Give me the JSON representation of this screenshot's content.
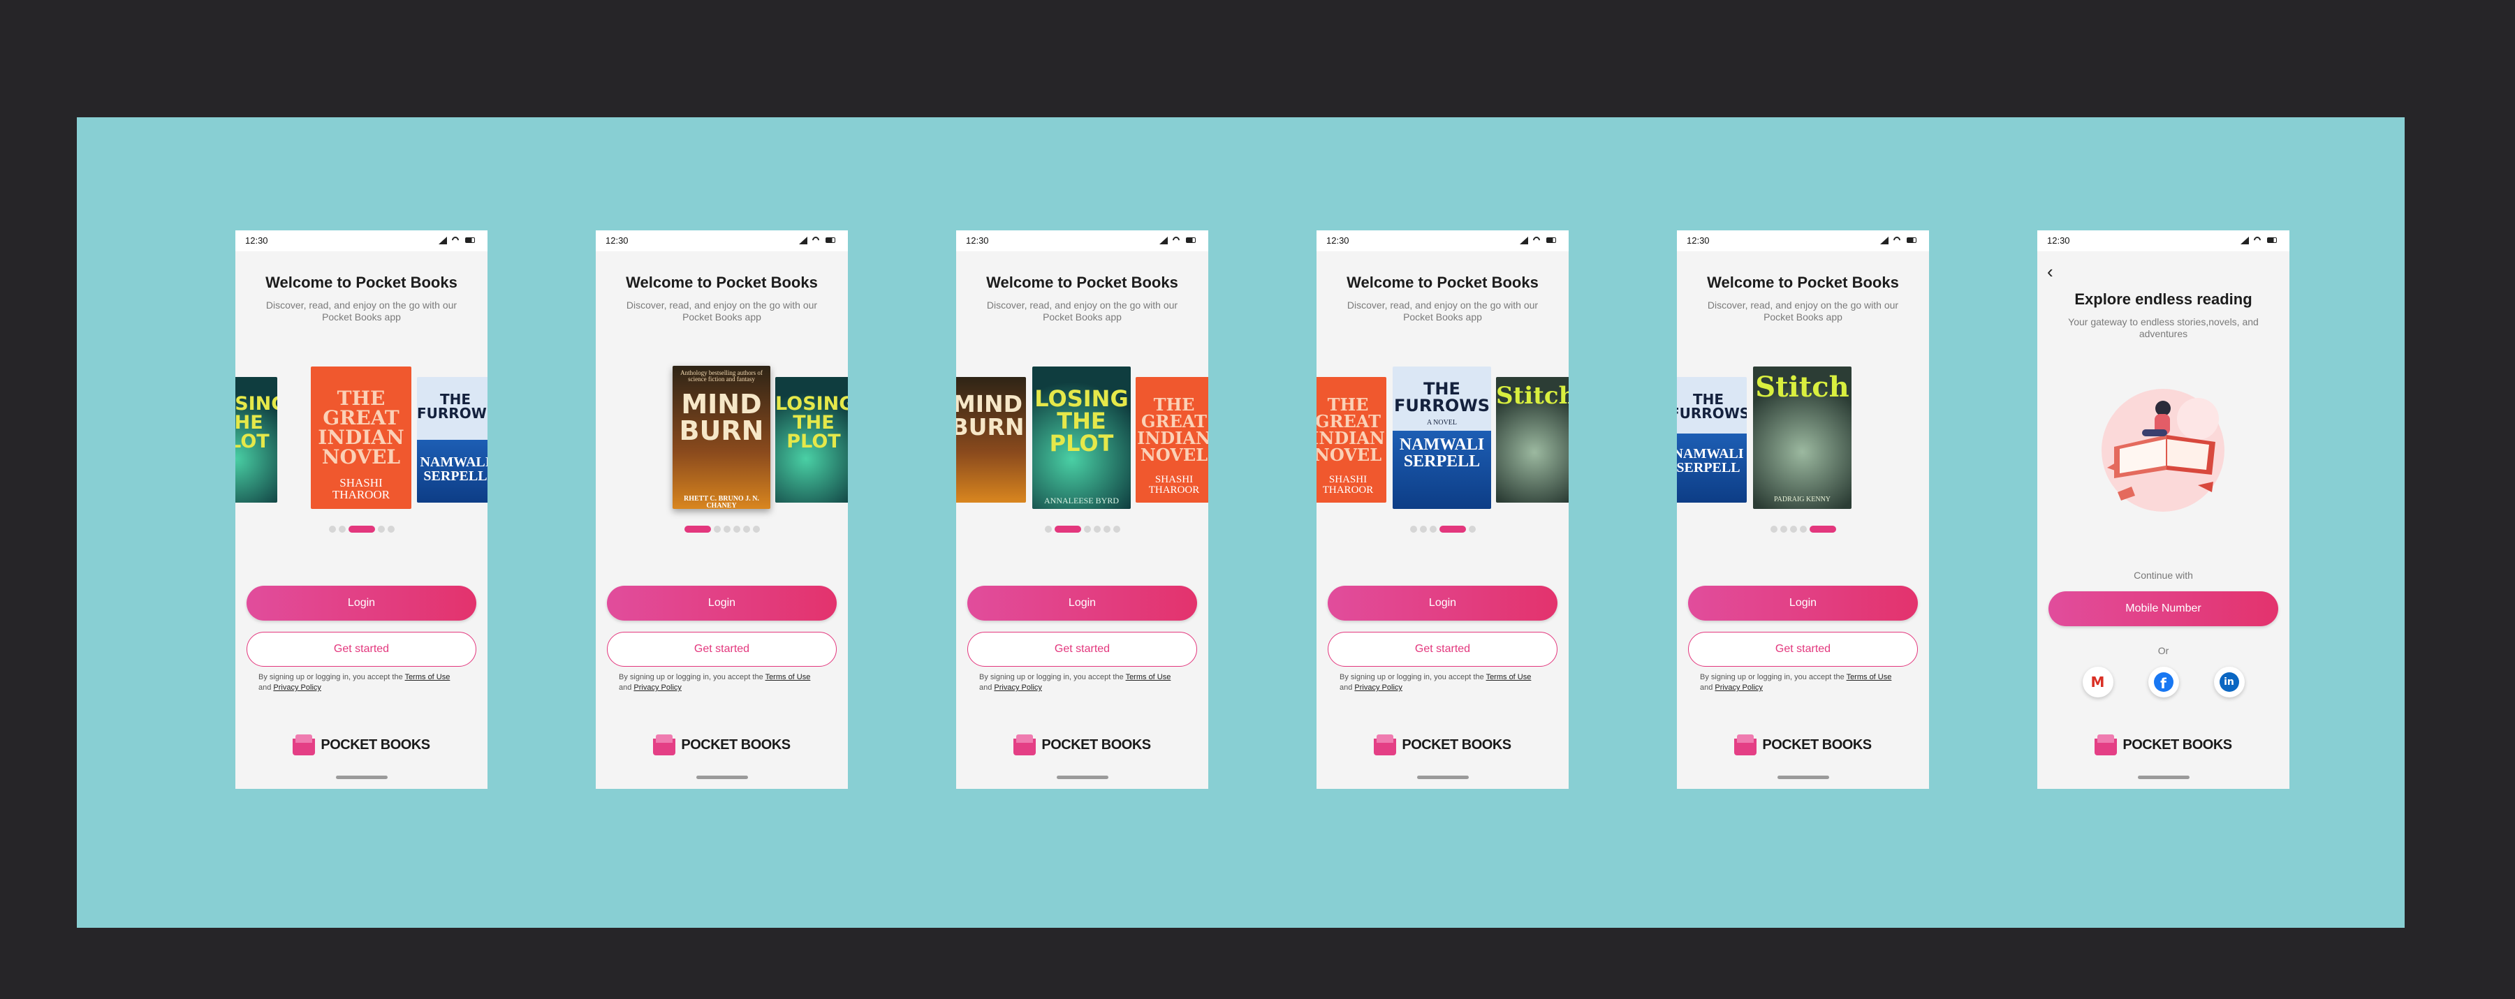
{
  "colors": {
    "canvas": "#262528",
    "board": "#88cfd3",
    "accent": "#e3377d",
    "screen": "#f4f4f4"
  },
  "status_time": "12:30",
  "welcome": {
    "title": "Welcome to Pocket Books",
    "subtitle": "Discover, read, and enjoy on the go with our Pocket Books app"
  },
  "buttons": {
    "login": "Login",
    "get_started": "Get started",
    "mobile": "Mobile Number"
  },
  "terms": {
    "prefix": "By signing up or logging in, you accept the",
    "terms": "Terms of Use",
    "and": "and",
    "privacy": "Privacy Policy"
  },
  "brand": {
    "name": "POCKET BOOKS"
  },
  "books": {
    "mind_burn": {
      "title": "MIND\nBURN",
      "author": "RHETT C. BRUNO   J. N. CHANEY",
      "tagline": "Anthology bestselling authors of science fiction and fantasy"
    },
    "losing_plot": {
      "title": "LOSING\nTHE\nPLOT",
      "author": "ANNALEESE BYRD"
    },
    "great_indian": {
      "title": "THE\nGREAT\nINDIAN\nNOVEL",
      "author": "SHASHI\nTHAROOR"
    },
    "furrows": {
      "title": "THE\nFURROWS",
      "sub": "A NOVEL",
      "author": "NAMWALI\nSERPELL"
    },
    "stitch": {
      "title": "Stitch",
      "author": "PADRAIG KENNY"
    }
  },
  "screens": [
    {
      "dots": 5,
      "active": 2
    },
    {
      "dots": 6,
      "active": 0
    },
    {
      "dots": 6,
      "active": 1
    },
    {
      "dots": 5,
      "active": 3
    },
    {
      "dots": 5,
      "active": 4
    }
  ],
  "explore": {
    "title": "Explore endless reading",
    "subtitle": "Your gateway to endless stories,novels, and adventures",
    "continue_with": "Continue with",
    "or": "Or",
    "social": [
      "gmail-icon",
      "facebook-icon",
      "linkedin-icon"
    ]
  }
}
